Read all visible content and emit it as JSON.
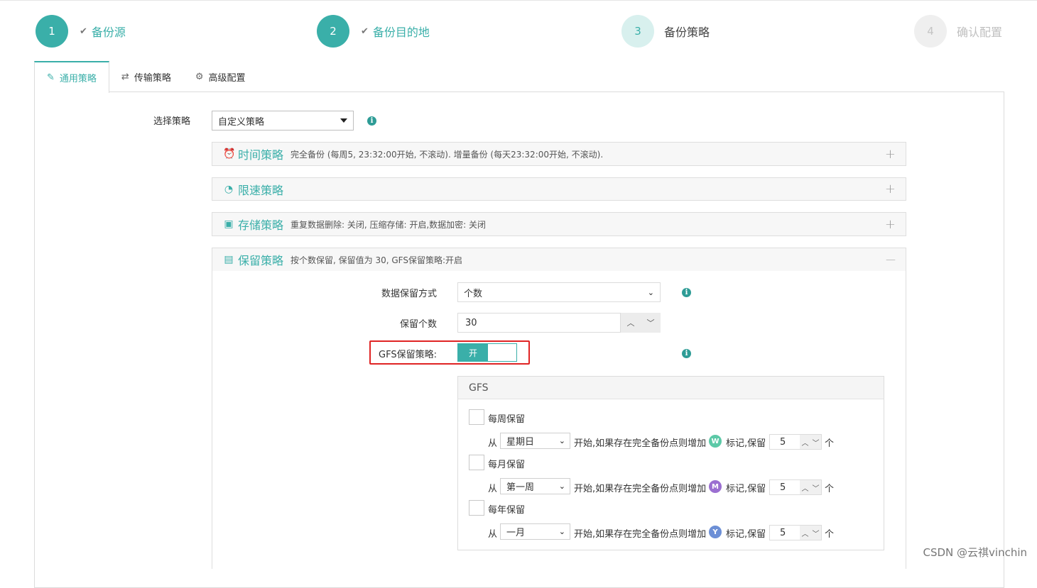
{
  "steps": [
    {
      "num": "1",
      "label": "备份源",
      "state": "done"
    },
    {
      "num": "2",
      "label": "备份目的地",
      "state": "done"
    },
    {
      "num": "3",
      "label": "备份策略",
      "state": "active"
    },
    {
      "num": "4",
      "label": "确认配置",
      "state": "todo"
    }
  ],
  "tabs": [
    {
      "label": "通用策略",
      "icon": "pencil-icon"
    },
    {
      "label": "传输策略",
      "icon": "transfer-icon"
    },
    {
      "label": "高级配置",
      "icon": "gear-icon"
    }
  ],
  "strategy": {
    "label": "选择策略",
    "value": "自定义策略"
  },
  "panels": {
    "time": {
      "title": "时间策略",
      "desc": "完全备份 (每周5, 23:32:00开始, 不滚动). 增量备份 (每天23:32:00开始, 不滚动).",
      "toggle": "+"
    },
    "speed": {
      "title": "限速策略",
      "desc": "",
      "toggle": "+"
    },
    "storage": {
      "title": "存储策略",
      "desc": "重复数据删除: 关闭, 压缩存储: 开启,数据加密: 关闭",
      "toggle": "+"
    },
    "retention": {
      "title": "保留策略",
      "desc": "按个数保留, 保留值为 30, GFS保留策略:开启",
      "toggle": "—"
    }
  },
  "retention": {
    "mode_label": "数据保留方式",
    "mode_value": "个数",
    "count_label": "保留个数",
    "count_value": "30",
    "gfs_label": "GFS保留策略:",
    "gfs_switch": "开"
  },
  "gfs": {
    "title": "GFS",
    "rows": [
      {
        "check_label": "每周保留",
        "from": "从",
        "select": "星期日",
        "mid": "开始,如果存在完全备份点则增加",
        "badge": "W",
        "badge_color": "#5cc9a7",
        "mark": "标记,保留",
        "count": "5",
        "unit": "个"
      },
      {
        "check_label": "每月保留",
        "from": "从",
        "select": "第一周",
        "mid": "开始,如果存在完全备份点则增加",
        "badge": "M",
        "badge_color": "#9b6fd1",
        "mark": "标记,保留",
        "count": "5",
        "unit": "个"
      },
      {
        "check_label": "每年保留",
        "from": "从",
        "select": "一月",
        "mid": "开始,如果存在完全备份点则增加",
        "badge": "Y",
        "badge_color": "#6c8fd6",
        "mark": "标记,保留",
        "count": "5",
        "unit": "个"
      }
    ]
  },
  "watermark": "CSDN @云祺vinchin",
  "colors": {
    "accent": "#3aafa9",
    "highlight": "#e02424"
  }
}
